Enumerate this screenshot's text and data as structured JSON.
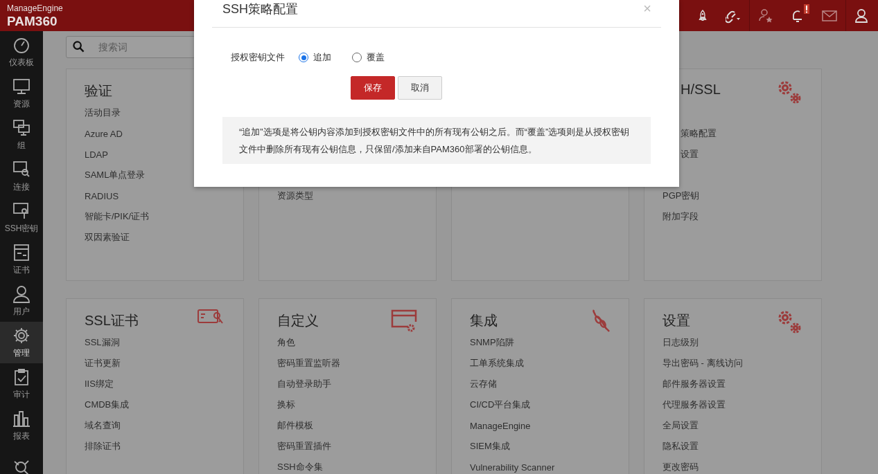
{
  "header": {
    "brand": "ManageEngine",
    "product": "PAM360"
  },
  "sidebar": {
    "items": [
      {
        "label": "仪表板",
        "selected": false
      },
      {
        "label": "资源",
        "selected": false
      },
      {
        "label": "组",
        "selected": false
      },
      {
        "label": "连接",
        "selected": false
      },
      {
        "label": "SSH密钥",
        "selected": false
      },
      {
        "label": "证书",
        "selected": false
      },
      {
        "label": "用户",
        "selected": false
      },
      {
        "label": "管理",
        "selected": true
      },
      {
        "label": "审计",
        "selected": false
      },
      {
        "label": "报表",
        "selected": false
      },
      {
        "selected": false
      }
    ]
  },
  "search": {
    "placeholder": "搜索词"
  },
  "cards": [
    {
      "title": "验证",
      "items": [
        "活动目录",
        "Azure AD",
        "LDAP",
        "SAML单点登录",
        "RADIUS",
        "智能卡/PIK/证书",
        "双因素验证"
      ]
    },
    {
      "items": [
        "资源类型"
      ]
    },
    {
      "title": "H/SSL",
      "items": [
        "策略配置",
        "设置",
        "PGP密钥",
        "附加字段"
      ]
    },
    {
      "title": "SSL证书",
      "items": [
        "SSL漏洞",
        "证书更新",
        "IIS绑定",
        "CMDB集成",
        "域名查询",
        "排除证书"
      ]
    },
    {
      "title": "自定义",
      "items": [
        "角色",
        "密码重置监听器",
        "自动登录助手",
        "换标",
        "邮件模板",
        "密码重置插件",
        "SSH命令集"
      ]
    },
    {
      "title": "集成",
      "items": [
        "SNMP陷阱",
        "工单系统集成",
        "云存储",
        "CI/CD平台集成",
        "ManageEngine",
        "SIEM集成",
        "Vulnerability Scanner"
      ]
    },
    {
      "title": "设置",
      "items": [
        "日志级别",
        "导出密码 - 离线访问",
        "邮件服务器设置",
        "代理服务器设置",
        "全局设置",
        "隐私设置",
        "更改密码"
      ]
    }
  ],
  "dialog": {
    "title": "SSH策略配置",
    "close": "×",
    "field_label": "授权密钥文件",
    "options": [
      {
        "label": "追加",
        "selected": true
      },
      {
        "label": "覆盖",
        "selected": false
      }
    ],
    "buttons": [
      {
        "label": "保存",
        "kind": "primary"
      },
      {
        "label": "取消",
        "kind": "secondary"
      }
    ],
    "note": "“追加”选项是将公钥内容添加到授权密钥文件中的所有现有公钥之后。而“覆盖”选项则是从授权密钥文件中删除所有现有公钥信息，只保留/添加来自PAM360部署的公钥信息。"
  }
}
